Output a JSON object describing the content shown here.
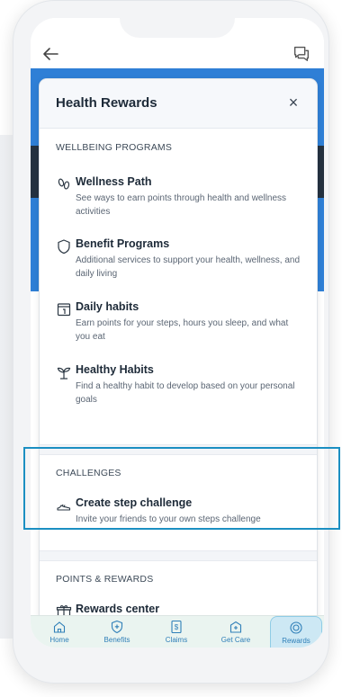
{
  "sheet": {
    "title": "Health Rewards",
    "close_label": "×"
  },
  "sections": {
    "wellbeing": {
      "heading": "WELLBEING PROGRAMS",
      "items": [
        {
          "icon": "footsteps-icon",
          "title": "Wellness Path",
          "desc": "See ways to earn points through health and wellness activities"
        },
        {
          "icon": "shield-icon",
          "title": "Benefit Programs",
          "desc": "Additional services to support your health, wellness, and daily living"
        },
        {
          "icon": "calendar-icon",
          "title": "Daily habits",
          "desc": "Earn points for your steps, hours you sleep, and what you eat"
        },
        {
          "icon": "sprout-icon",
          "title": "Healthy Habits",
          "desc": "Find a healthy habit to develop based on your personal goals"
        }
      ]
    },
    "challenges": {
      "heading": "CHALLENGES",
      "items": [
        {
          "icon": "sneaker-icon",
          "title": "Create step challenge",
          "desc": "Invite your friends to your own steps challenge"
        }
      ]
    },
    "points": {
      "heading": "POINTS & REWARDS",
      "items": [
        {
          "icon": "gift-icon",
          "title": "Rewards center",
          "desc": ""
        }
      ]
    }
  },
  "tabbar": {
    "tabs": [
      {
        "icon": "home-icon",
        "label": "Home"
      },
      {
        "icon": "shield-plus-icon",
        "label": "Benefits"
      },
      {
        "icon": "dollar-doc-icon",
        "label": "Claims"
      },
      {
        "icon": "clinic-icon",
        "label": "Get Care"
      },
      {
        "icon": "rewards-icon",
        "label": "Rewards"
      }
    ],
    "active": "Rewards"
  },
  "colors": {
    "brand_blue": "#2f7fd6",
    "highlight": "#1b8fc2",
    "tab_text": "#2f7fb8"
  }
}
